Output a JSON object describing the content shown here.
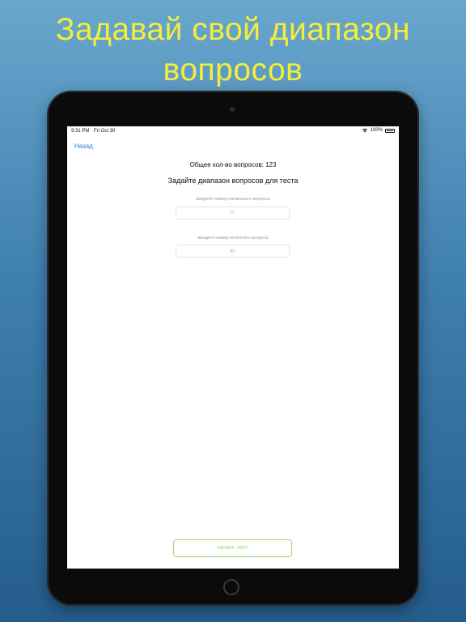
{
  "promo": {
    "headline_line1": "Задавай свой диапазон",
    "headline_line2": "вопросов",
    "headline_color": "#f4ee3a"
  },
  "status_bar": {
    "time": "9:31 PM",
    "date": "Fri Oct 30",
    "battery": "100%",
    "wifi_icon": "wifi-icon",
    "battery_icon": "battery-icon"
  },
  "nav": {
    "back_label": "Назад",
    "accent_color": "#2c7bd7"
  },
  "content": {
    "total_questions": "Общее кол-во вопросов: 123",
    "range_title": "Задайте диапазон вопросов для теста",
    "from_label": "введите номер начального вопроса",
    "from_placeholder": "от",
    "to_label": "введите номер конечного вопроса",
    "to_placeholder": "до",
    "start_button": "начать тест",
    "start_button_color": "#9ad865"
  }
}
